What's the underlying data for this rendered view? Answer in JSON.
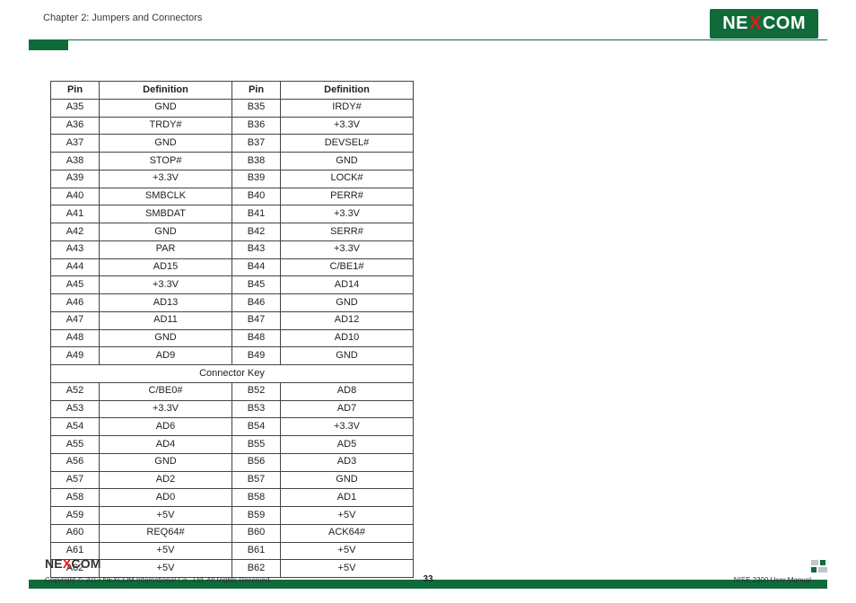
{
  "header": {
    "chapter": "Chapter 2: Jumpers and Connectors",
    "logo_left": "NE",
    "logo_x": "X",
    "logo_right": "COM"
  },
  "table": {
    "headers": {
      "pinA": "Pin",
      "defA": "Definition",
      "pinB": "Pin",
      "defB": "Definition"
    },
    "rows_top": [
      {
        "pa": "A35",
        "da": "GND",
        "pb": "B35",
        "db": "IRDY#"
      },
      {
        "pa": "A36",
        "da": "TRDY#",
        "pb": "B36",
        "db": "+3.3V"
      },
      {
        "pa": "A37",
        "da": "GND",
        "pb": "B37",
        "db": "DEVSEL#"
      },
      {
        "pa": "A38",
        "da": "STOP#",
        "pb": "B38",
        "db": "GND"
      },
      {
        "pa": "A39",
        "da": "+3.3V",
        "pb": "B39",
        "db": "LOCK#"
      },
      {
        "pa": "A40",
        "da": "SMBCLK",
        "pb": "B40",
        "db": "PERR#"
      },
      {
        "pa": "A41",
        "da": "SMBDAT",
        "pb": "B41",
        "db": "+3.3V"
      },
      {
        "pa": "A42",
        "da": "GND",
        "pb": "B42",
        "db": "SERR#"
      },
      {
        "pa": "A43",
        "da": "PAR",
        "pb": "B43",
        "db": "+3.3V"
      },
      {
        "pa": "A44",
        "da": "AD15",
        "pb": "B44",
        "db": "C/BE1#"
      },
      {
        "pa": "A45",
        "da": "+3.3V",
        "pb": "B45",
        "db": "AD14"
      },
      {
        "pa": "A46",
        "da": "AD13",
        "pb": "B46",
        "db": "GND"
      },
      {
        "pa": "A47",
        "da": "AD11",
        "pb": "B47",
        "db": "AD12"
      },
      {
        "pa": "A48",
        "da": "GND",
        "pb": "B48",
        "db": "AD10"
      },
      {
        "pa": "A49",
        "da": "AD9",
        "pb": "B49",
        "db": "GND"
      }
    ],
    "key_label": "Connector Key",
    "rows_bottom": [
      {
        "pa": "A52",
        "da": "C/BE0#",
        "pb": "B52",
        "db": "AD8"
      },
      {
        "pa": "A53",
        "da": "+3.3V",
        "pb": "B53",
        "db": "AD7"
      },
      {
        "pa": "A54",
        "da": "AD6",
        "pb": "B54",
        "db": "+3.3V"
      },
      {
        "pa": "A55",
        "da": "AD4",
        "pb": "B55",
        "db": "AD5"
      },
      {
        "pa": "A56",
        "da": "GND",
        "pb": "B56",
        "db": "AD3"
      },
      {
        "pa": "A57",
        "da": "AD2",
        "pb": "B57",
        "db": "GND"
      },
      {
        "pa": "A58",
        "da": "AD0",
        "pb": "B58",
        "db": "AD1"
      },
      {
        "pa": "A59",
        "da": "+5V",
        "pb": "B59",
        "db": "+5V"
      },
      {
        "pa": "A60",
        "da": "REQ64#",
        "pb": "B60",
        "db": "ACK64#"
      },
      {
        "pa": "A61",
        "da": "+5V",
        "pb": "B61",
        "db": "+5V"
      },
      {
        "pa": "A62",
        "da": "+5V",
        "pb": "B62",
        "db": "+5V"
      }
    ]
  },
  "footer": {
    "logo_left": "NE",
    "logo_x": "X",
    "logo_right": "COM",
    "copyright": "Copyright © 2013 NEXCOM International Co., Ltd. All Rights Reserved.",
    "page": "33",
    "manual": "NISE 2300 User Manual"
  }
}
